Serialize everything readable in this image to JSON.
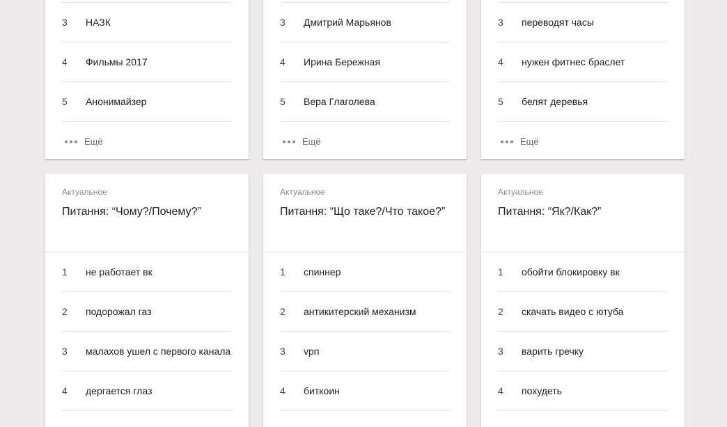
{
  "top_cards": [
    {
      "rows": [
        {
          "rank": "3",
          "query": "НАЗК"
        },
        {
          "rank": "4",
          "query": "Фильмы 2017"
        },
        {
          "rank": "5",
          "query": "Анонимайзер"
        }
      ],
      "more_label": "Ещё"
    },
    {
      "rows": [
        {
          "rank": "3",
          "query": "Дмитрий Марьянов"
        },
        {
          "rank": "4",
          "query": "Ирина Бережная"
        },
        {
          "rank": "5",
          "query": "Вера Глаголева"
        }
      ],
      "more_label": "Ещё"
    },
    {
      "rows": [
        {
          "rank": "3",
          "query": "переводят часы"
        },
        {
          "rank": "4",
          "query": "нужен фитнес браслет"
        },
        {
          "rank": "5",
          "query": "белят деревья"
        }
      ],
      "more_label": "Ещё"
    }
  ],
  "bottom_cards": [
    {
      "category": "Актуальное",
      "title": "Питання: “Чому?/Почему?”",
      "rows": [
        {
          "rank": "1",
          "query": "не работает вк"
        },
        {
          "rank": "2",
          "query": "подорожал газ"
        },
        {
          "rank": "3",
          "query": "малахов ушел с первого канала"
        },
        {
          "rank": "4",
          "query": "дергается глаз"
        }
      ]
    },
    {
      "category": "Актуальное",
      "title": "Питання: “Що таке?/Что такое?”",
      "rows": [
        {
          "rank": "1",
          "query": "спиннер"
        },
        {
          "rank": "2",
          "query": "антикитерский механизм"
        },
        {
          "rank": "3",
          "query": "vpn"
        },
        {
          "rank": "4",
          "query": "биткоин"
        }
      ]
    },
    {
      "category": "Актуальное",
      "title": "Питання: “Як?/Как?”",
      "rows": [
        {
          "rank": "1",
          "query": "обойти блокировку вк"
        },
        {
          "rank": "2",
          "query": "скачать видео с ютуба"
        },
        {
          "rank": "3",
          "query": "варить гречку"
        },
        {
          "rank": "4",
          "query": "похудеть"
        }
      ]
    }
  ]
}
